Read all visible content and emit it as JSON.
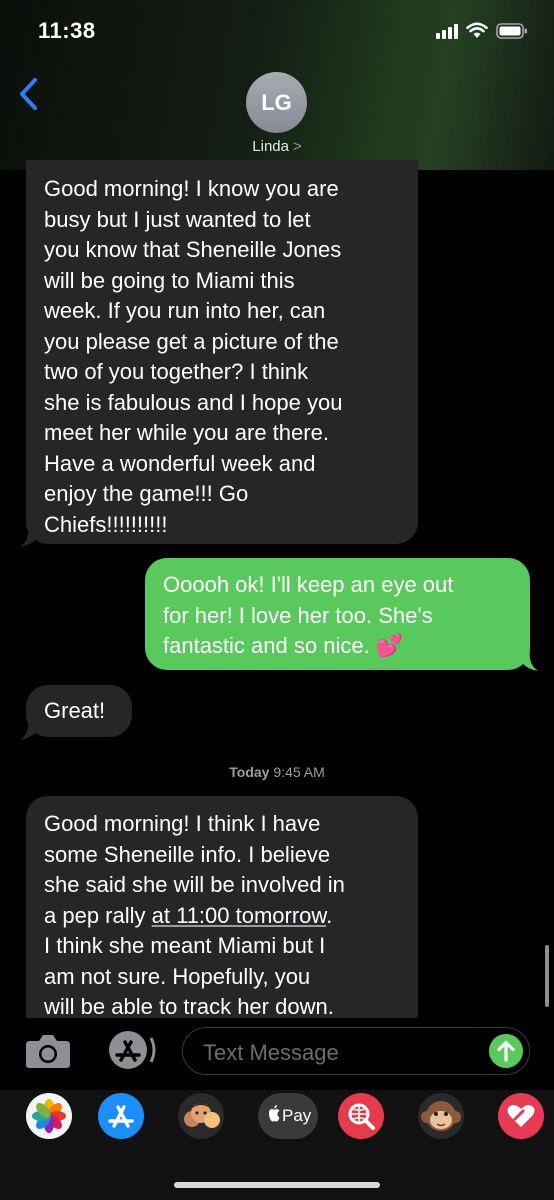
{
  "status_bar": {
    "time": "11:38"
  },
  "header": {
    "avatar_initials": "LG",
    "contact_name": "Linda",
    "chevron": ">"
  },
  "messages": [
    {
      "direction": "incoming",
      "lines": [
        "Good morning! I know you are",
        "busy but I just wanted to let",
        "you know that Sheneille Jones",
        "will be going to Miami this",
        "week. If you run into her, can",
        "you please get a picture of the",
        "two of you together? I think",
        "she is fabulous and I hope you",
        "meet  her while you are there.",
        "Have a wonderful week and",
        "enjoy the game!!! Go",
        "Chiefs!!!!!!!!!!"
      ]
    },
    {
      "direction": "outgoing",
      "lines": [
        "Ooooh ok! I'll keep an eye out",
        "for her! I love her too. She's",
        "fantastic and so nice. 💕"
      ]
    },
    {
      "direction": "incoming",
      "lines": [
        "Great!"
      ]
    },
    {
      "direction": "incoming",
      "lines_before_link": [
        "Good morning! I think I have",
        "some Sheneille info. I believe",
        "she said she will be involved in"
      ],
      "line4_prefix": "a pep rally ",
      "link_text": "at 11:00 tomorrow",
      "line4_suffix": ".",
      "lines_after_link": [
        "I think she meant Miami but I",
        "am not sure. Hopefully, you",
        "will be able to track her down."
      ]
    }
  ],
  "timestamp": {
    "day": "Today",
    "time": "9:45 AM"
  },
  "composer": {
    "placeholder": "Text Message"
  },
  "app_tray": {
    "apple_pay_label": "Pay"
  },
  "colors": {
    "incoming_bubble": "#262629",
    "outgoing_bubble": "#59c85d",
    "accent_blue": "#2f7cf6"
  }
}
